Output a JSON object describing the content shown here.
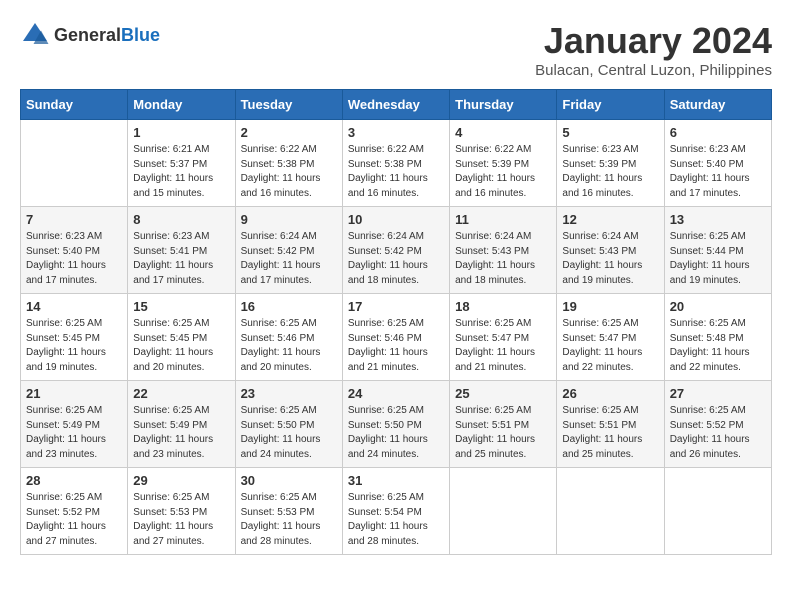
{
  "header": {
    "logo_general": "General",
    "logo_blue": "Blue",
    "month_year": "January 2024",
    "location": "Bulacan, Central Luzon, Philippines"
  },
  "days_of_week": [
    "Sunday",
    "Monday",
    "Tuesday",
    "Wednesday",
    "Thursday",
    "Friday",
    "Saturday"
  ],
  "weeks": [
    [
      {
        "day": "",
        "detail": ""
      },
      {
        "day": "1",
        "detail": "Sunrise: 6:21 AM\nSunset: 5:37 PM\nDaylight: 11 hours\nand 15 minutes."
      },
      {
        "day": "2",
        "detail": "Sunrise: 6:22 AM\nSunset: 5:38 PM\nDaylight: 11 hours\nand 16 minutes."
      },
      {
        "day": "3",
        "detail": "Sunrise: 6:22 AM\nSunset: 5:38 PM\nDaylight: 11 hours\nand 16 minutes."
      },
      {
        "day": "4",
        "detail": "Sunrise: 6:22 AM\nSunset: 5:39 PM\nDaylight: 11 hours\nand 16 minutes."
      },
      {
        "day": "5",
        "detail": "Sunrise: 6:23 AM\nSunset: 5:39 PM\nDaylight: 11 hours\nand 16 minutes."
      },
      {
        "day": "6",
        "detail": "Sunrise: 6:23 AM\nSunset: 5:40 PM\nDaylight: 11 hours\nand 17 minutes."
      }
    ],
    [
      {
        "day": "7",
        "detail": "Sunrise: 6:23 AM\nSunset: 5:40 PM\nDaylight: 11 hours\nand 17 minutes."
      },
      {
        "day": "8",
        "detail": "Sunrise: 6:23 AM\nSunset: 5:41 PM\nDaylight: 11 hours\nand 17 minutes."
      },
      {
        "day": "9",
        "detail": "Sunrise: 6:24 AM\nSunset: 5:42 PM\nDaylight: 11 hours\nand 17 minutes."
      },
      {
        "day": "10",
        "detail": "Sunrise: 6:24 AM\nSunset: 5:42 PM\nDaylight: 11 hours\nand 18 minutes."
      },
      {
        "day": "11",
        "detail": "Sunrise: 6:24 AM\nSunset: 5:43 PM\nDaylight: 11 hours\nand 18 minutes."
      },
      {
        "day": "12",
        "detail": "Sunrise: 6:24 AM\nSunset: 5:43 PM\nDaylight: 11 hours\nand 19 minutes."
      },
      {
        "day": "13",
        "detail": "Sunrise: 6:25 AM\nSunset: 5:44 PM\nDaylight: 11 hours\nand 19 minutes."
      }
    ],
    [
      {
        "day": "14",
        "detail": "Sunrise: 6:25 AM\nSunset: 5:45 PM\nDaylight: 11 hours\nand 19 minutes."
      },
      {
        "day": "15",
        "detail": "Sunrise: 6:25 AM\nSunset: 5:45 PM\nDaylight: 11 hours\nand 20 minutes."
      },
      {
        "day": "16",
        "detail": "Sunrise: 6:25 AM\nSunset: 5:46 PM\nDaylight: 11 hours\nand 20 minutes."
      },
      {
        "day": "17",
        "detail": "Sunrise: 6:25 AM\nSunset: 5:46 PM\nDaylight: 11 hours\nand 21 minutes."
      },
      {
        "day": "18",
        "detail": "Sunrise: 6:25 AM\nSunset: 5:47 PM\nDaylight: 11 hours\nand 21 minutes."
      },
      {
        "day": "19",
        "detail": "Sunrise: 6:25 AM\nSunset: 5:47 PM\nDaylight: 11 hours\nand 22 minutes."
      },
      {
        "day": "20",
        "detail": "Sunrise: 6:25 AM\nSunset: 5:48 PM\nDaylight: 11 hours\nand 22 minutes."
      }
    ],
    [
      {
        "day": "21",
        "detail": "Sunrise: 6:25 AM\nSunset: 5:49 PM\nDaylight: 11 hours\nand 23 minutes."
      },
      {
        "day": "22",
        "detail": "Sunrise: 6:25 AM\nSunset: 5:49 PM\nDaylight: 11 hours\nand 23 minutes."
      },
      {
        "day": "23",
        "detail": "Sunrise: 6:25 AM\nSunset: 5:50 PM\nDaylight: 11 hours\nand 24 minutes."
      },
      {
        "day": "24",
        "detail": "Sunrise: 6:25 AM\nSunset: 5:50 PM\nDaylight: 11 hours\nand 24 minutes."
      },
      {
        "day": "25",
        "detail": "Sunrise: 6:25 AM\nSunset: 5:51 PM\nDaylight: 11 hours\nand 25 minutes."
      },
      {
        "day": "26",
        "detail": "Sunrise: 6:25 AM\nSunset: 5:51 PM\nDaylight: 11 hours\nand 25 minutes."
      },
      {
        "day": "27",
        "detail": "Sunrise: 6:25 AM\nSunset: 5:52 PM\nDaylight: 11 hours\nand 26 minutes."
      }
    ],
    [
      {
        "day": "28",
        "detail": "Sunrise: 6:25 AM\nSunset: 5:52 PM\nDaylight: 11 hours\nand 27 minutes."
      },
      {
        "day": "29",
        "detail": "Sunrise: 6:25 AM\nSunset: 5:53 PM\nDaylight: 11 hours\nand 27 minutes."
      },
      {
        "day": "30",
        "detail": "Sunrise: 6:25 AM\nSunset: 5:53 PM\nDaylight: 11 hours\nand 28 minutes."
      },
      {
        "day": "31",
        "detail": "Sunrise: 6:25 AM\nSunset: 5:54 PM\nDaylight: 11 hours\nand 28 minutes."
      },
      {
        "day": "",
        "detail": ""
      },
      {
        "day": "",
        "detail": ""
      },
      {
        "day": "",
        "detail": ""
      }
    ]
  ]
}
